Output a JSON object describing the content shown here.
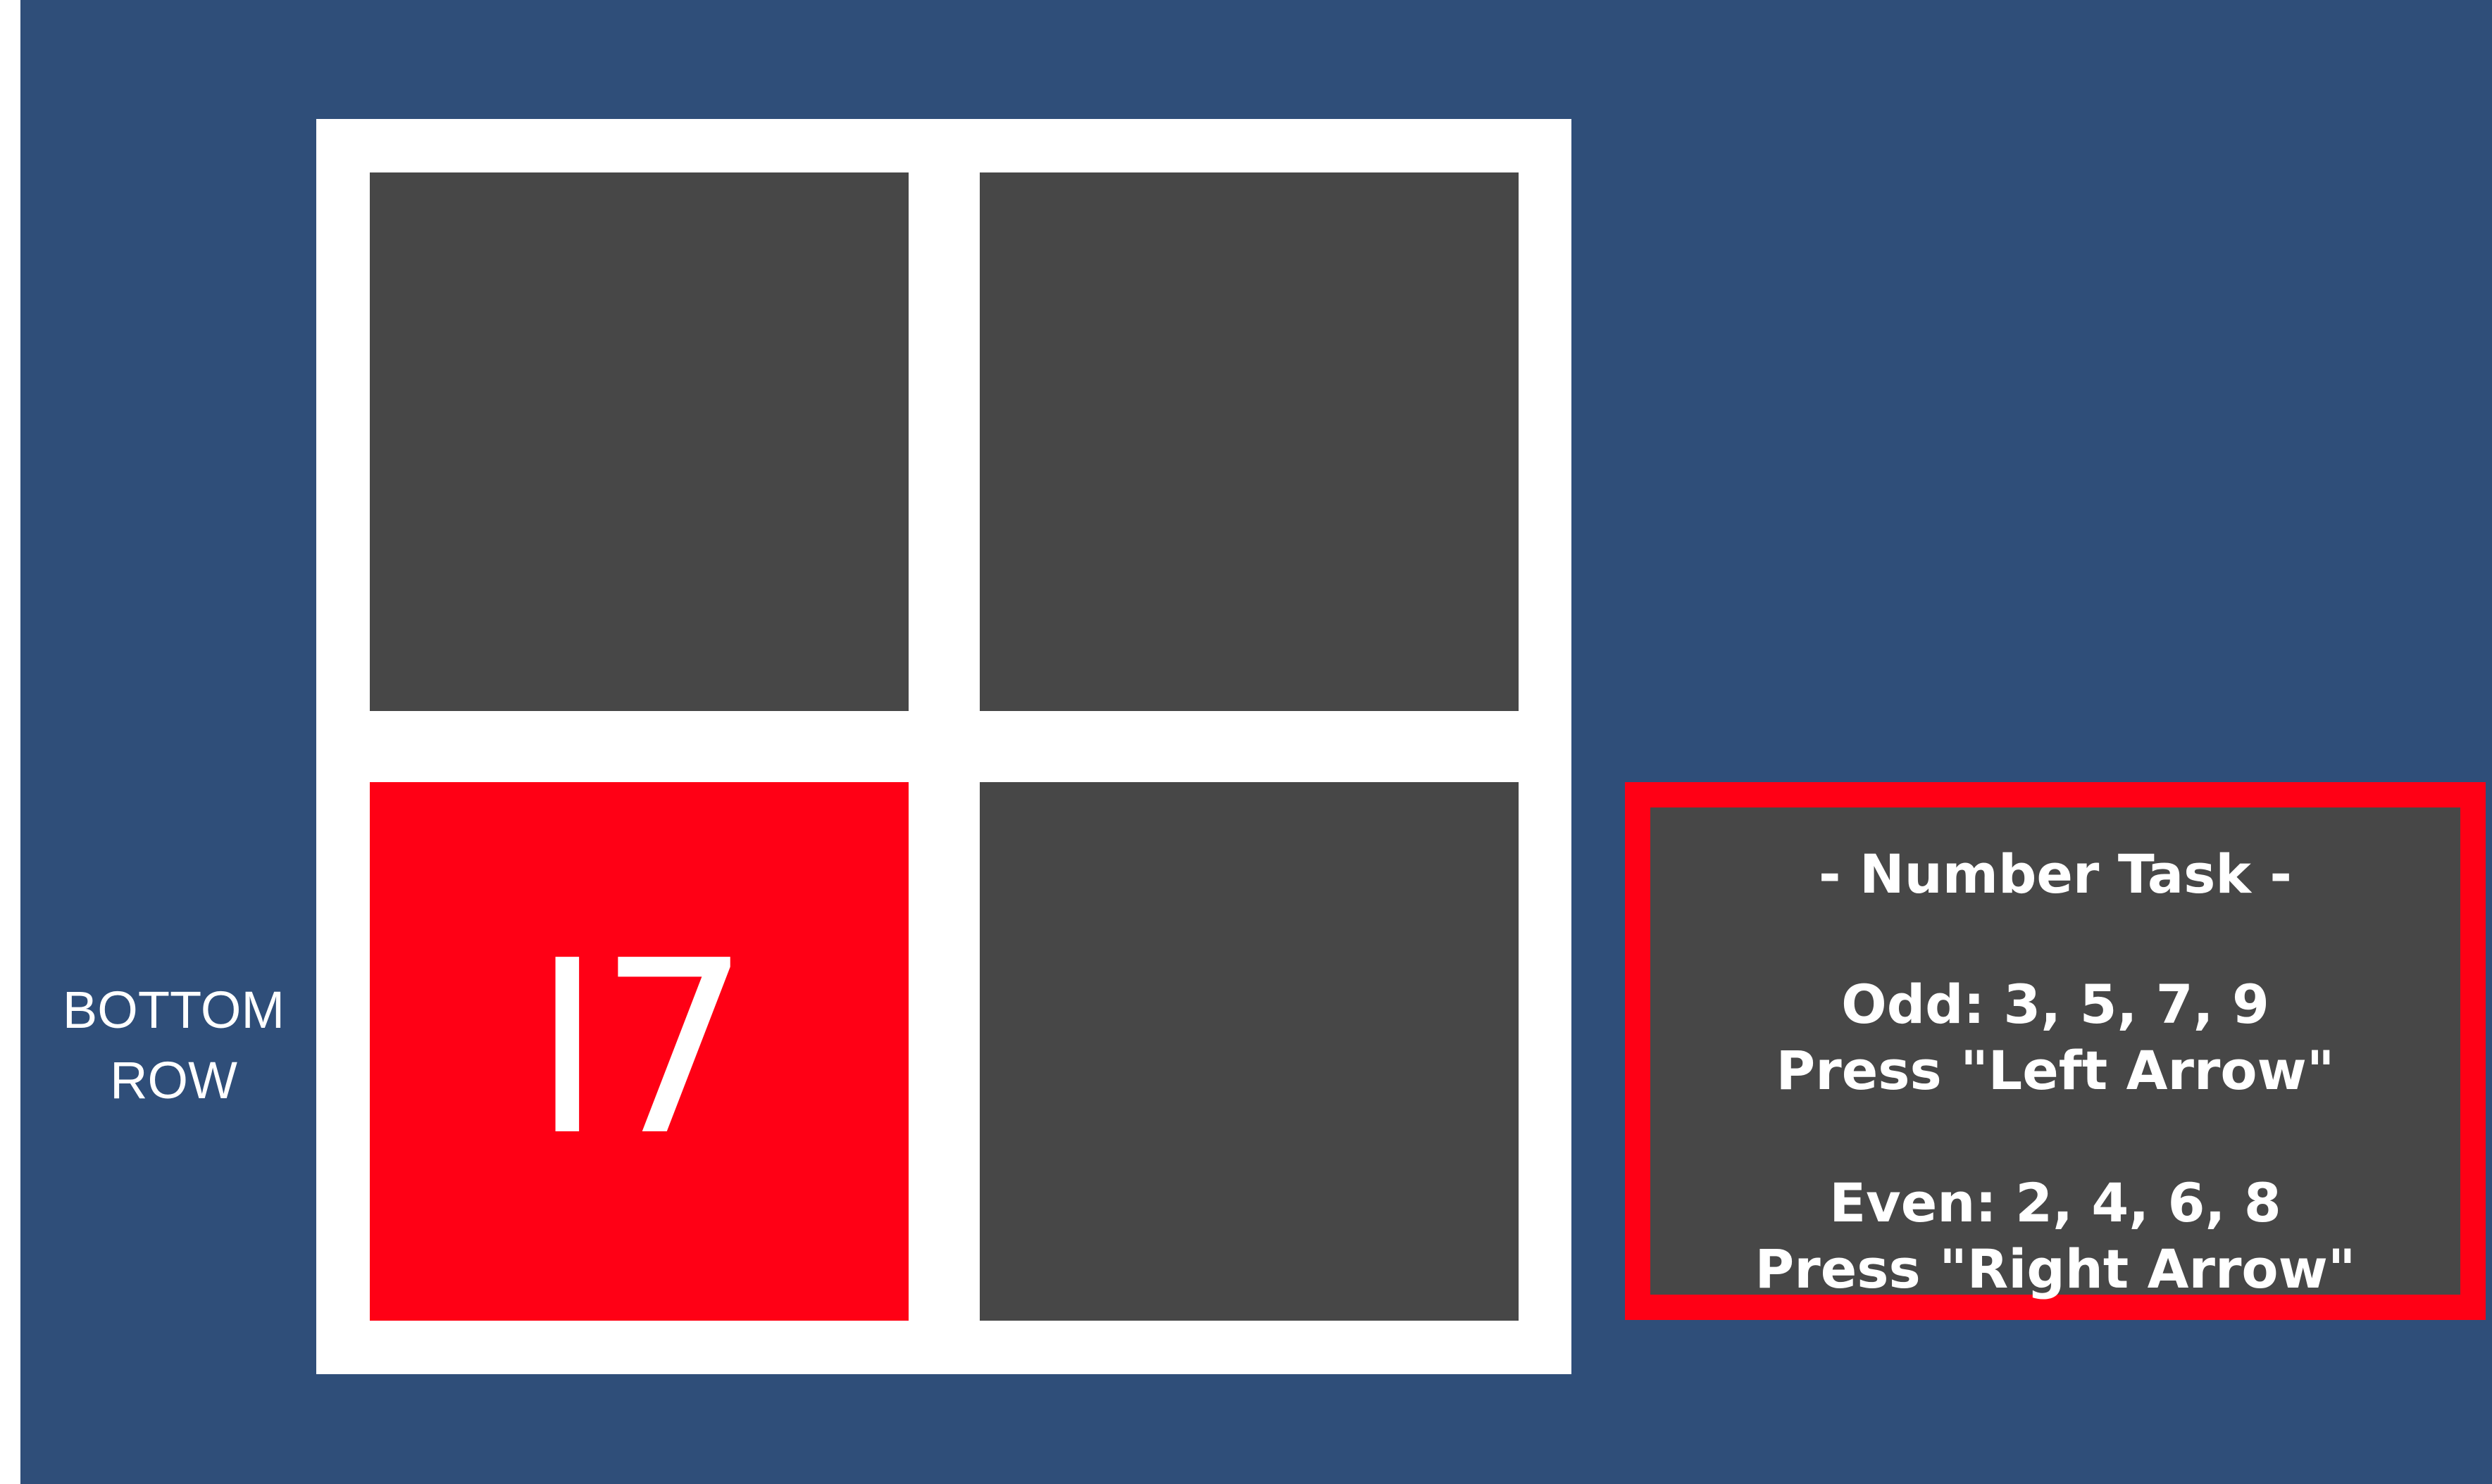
{
  "colors": {
    "background": "#2f4e79",
    "frame": "#ffffff",
    "cell": "#474747",
    "highlight": "#ff0015",
    "text": "#ffffff"
  },
  "side_label": {
    "line1": "BOTTOM",
    "line2": "ROW"
  },
  "grid": {
    "rows": 2,
    "cols": 2,
    "active_cell": "bottom-left",
    "cells": [
      {
        "position": "top-left",
        "value": ""
      },
      {
        "position": "top-right",
        "value": ""
      },
      {
        "position": "bottom-left",
        "value": "I7"
      },
      {
        "position": "bottom-right",
        "value": ""
      }
    ]
  },
  "task_panel": {
    "title": "- Number Task -",
    "odd_rule": "Odd: 3, 5, 7, 9",
    "odd_action": "Press \"Left Arrow\"",
    "even_rule": "Even: 2, 4, 6, 8",
    "even_action": "Press \"Right Arrow\""
  }
}
